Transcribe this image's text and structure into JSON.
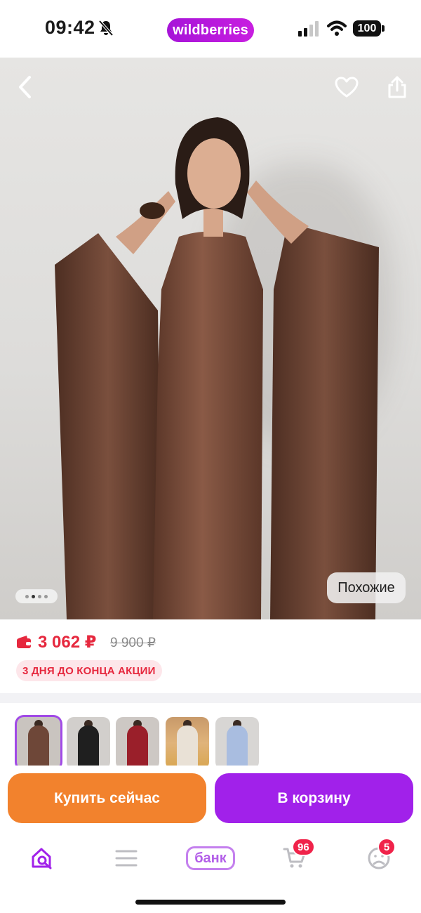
{
  "status_bar": {
    "time": "09:42",
    "app_logo": "wildberries",
    "battery": "100",
    "icons": [
      "bell-off-icon",
      "signal-icon",
      "wifi-icon",
      "battery-icon"
    ]
  },
  "gallery": {
    "similar_label": "Похожие",
    "pages_total": 4,
    "page_active": 2,
    "icons": [
      "chevron-left-icon",
      "heart-icon",
      "share-icon"
    ]
  },
  "pricing": {
    "price": "3 062 ₽",
    "old_price": "9 900 ₽",
    "promo": "3 ДНЯ ДО КОНЦА АКЦИИ",
    "price_color": "#e6283e"
  },
  "variants": [
    {
      "color": "#6e4738",
      "selected": true
    },
    {
      "color": "#1f1f1f",
      "selected": false
    },
    {
      "color": "#9a1f2a",
      "selected": false
    },
    {
      "color": "#e9e1d6",
      "selected": false
    },
    {
      "color": "#a9bde0",
      "selected": false
    }
  ],
  "actions": {
    "buy_now": "Купить сейчас",
    "add_to_cart": "В корзину",
    "buy_color": "#f2822d",
    "cart_color": "#a121ea"
  },
  "bottom_nav": {
    "bank_label": "банк",
    "cart_badge": "96",
    "profile_badge": "5",
    "accent": "#a121ea"
  }
}
